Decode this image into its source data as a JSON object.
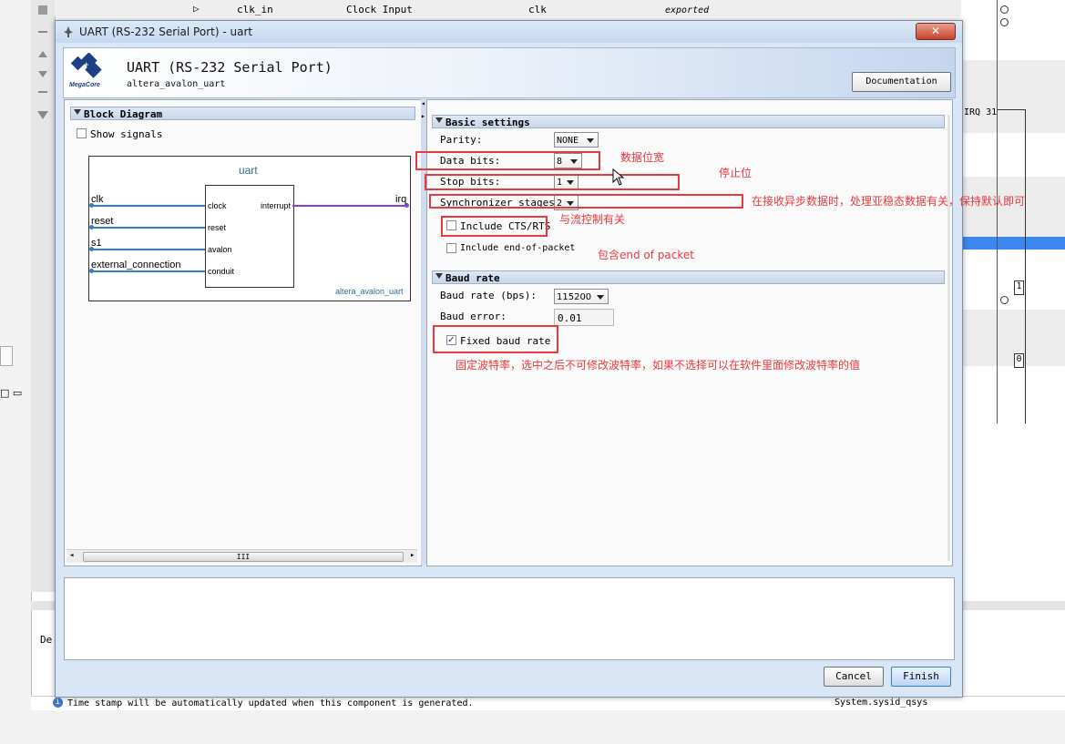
{
  "background": {
    "table_row": {
      "col1": "clk_in",
      "col2": "Clock Input",
      "col3": "clk",
      "col4": "exported"
    },
    "irq_label": "IRQ 31",
    "irq_val_1": "1",
    "irq_val_0": "0",
    "status_message": "Time stamp will be automatically updated when this component is generated.",
    "status_right": "System.sysid_qsys",
    "left_partial_label": "De"
  },
  "dialog": {
    "title": "UART (RS-232 Serial Port) - uart",
    "close_glyph": "✕",
    "header": {
      "title": "UART (RS-232 Serial Port)",
      "subtitle": "altera_avalon_uart",
      "logo_text": "MegaCore",
      "documentation_label": "Documentation"
    },
    "block_diagram": {
      "section_title": "Block Diagram",
      "show_signals_label": "Show signals",
      "show_signals_checked": false,
      "component_name": "uart",
      "component_type": "altera_avalon_uart",
      "left_ports": [
        {
          "name": "clk",
          "internal": "clock"
        },
        {
          "name": "reset",
          "internal": "reset"
        },
        {
          "name": "s1",
          "internal": "avalon"
        },
        {
          "name": "external_connection",
          "internal": "conduit"
        }
      ],
      "right_port_internal": "interrupt",
      "right_port_name": "irq",
      "scroll_grip": "III"
    },
    "basic_settings": {
      "section_title": "Basic settings",
      "parity_label": "Parity:",
      "parity_value": "NONE",
      "data_bits_label": "Data bits:",
      "data_bits_value": "8",
      "stop_bits_label": "Stop bits:",
      "stop_bits_value": "1",
      "sync_label": "Synchronizer stages:",
      "sync_value": "2",
      "cts_label": "Include CTS/RTS",
      "cts_checked": false,
      "eop_label": "Include end-of-packet",
      "eop_checked": false
    },
    "baud": {
      "section_title": "Baud rate",
      "rate_label": "Baud rate (bps):",
      "rate_value": "115200",
      "error_label": "Baud error:",
      "error_value": "0.01",
      "fixed_label": "Fixed baud rate",
      "fixed_checked": true,
      "check_glyph": "✓"
    },
    "buttons": {
      "cancel": "Cancel",
      "finish": "Finish"
    }
  },
  "annotations": {
    "data_bits": "数据位宽",
    "stop_bits": "停止位",
    "sync": "在接收异步数据时，处理亚稳态数据有关，保持默认即可",
    "cts": "与流控制有关",
    "eop": "包含end of packet",
    "fixed_baud": "固定波特率，选中之后不可修改波特率，如果不选择可以在软件里面修改波特率的值"
  },
  "colors": {
    "annotation_red": "#e8393d",
    "wire_blue": "#2f7fd6",
    "wire_purple": "#8a3fd0",
    "selection_blue": "#3d86f0"
  }
}
